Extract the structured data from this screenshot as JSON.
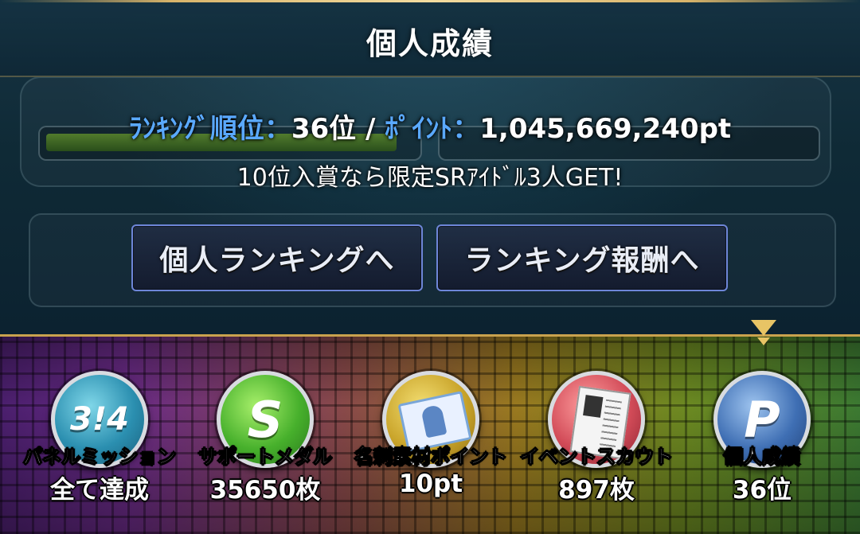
{
  "header": {
    "title": "個人成績"
  },
  "status": {
    "rank_label": "ﾗﾝｷﾝｸﾞ順位",
    "colon": "：",
    "rank_value": "36位",
    "separator": " / ",
    "point_label": "ﾎﾟｲﾝﾄ",
    "point_value": "1,045,669,240pt",
    "bonus_text": "10位入賞なら限定SRｱｲﾄﾞﾙ3人GET!"
  },
  "buttons": {
    "personal_ranking": "個人ランキングへ",
    "ranking_reward": "ランキング報酬へ"
  },
  "menu": {
    "items": [
      {
        "label": "パネルミッション",
        "value": "全て達成",
        "icon": "panel-mission-icon"
      },
      {
        "label": "サポートメダル",
        "value": "35650枚",
        "icon": "support-medal-icon"
      },
      {
        "label": "名刺素材ポイント",
        "value": "10pt",
        "icon": "business-card-icon"
      },
      {
        "label": "イベントスカウト",
        "value": "897枚",
        "icon": "scout-document-icon"
      },
      {
        "label": "個人成績",
        "value": "36位",
        "icon": "personal-results-icon"
      }
    ],
    "selected_index": 4,
    "colors": {
      "border_gold": "#c9a24e",
      "button_border": "#6e86d8",
      "label_blue": "#5aa9ff"
    }
  }
}
